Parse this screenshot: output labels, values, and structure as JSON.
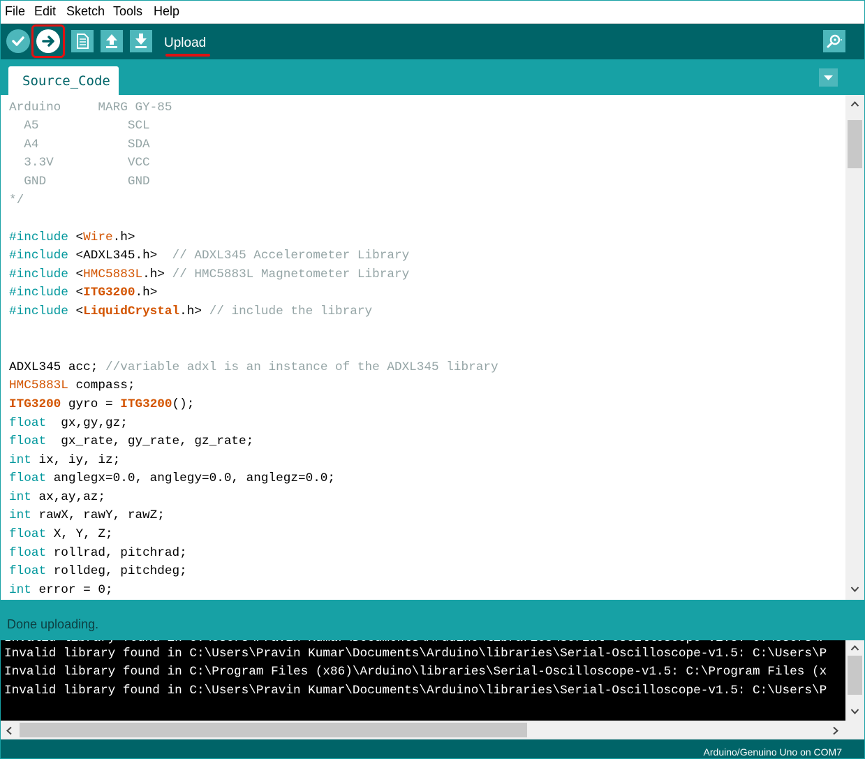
{
  "menu": [
    "File",
    "Edit",
    "Sketch",
    "Tools",
    "Help"
  ],
  "toolbar": {
    "hover_label": "Upload",
    "buttons": [
      "verify-icon",
      "upload-icon",
      "new-icon",
      "open-icon",
      "save-icon",
      "serial-monitor-icon"
    ]
  },
  "tab": {
    "label": "Source_Code"
  },
  "code": {
    "c1": "Arduino     MARG GY-85",
    "c2": "  A5            SCL",
    "c3": "  A4            SDA",
    "c4": "  3.3V          VCC",
    "c5": "  GND           GND",
    "c6": "*/",
    "inc_kw": "#include",
    "inc1_lib": "Wire",
    "inc1_tail": ".h>",
    "inc2_text": "ADXL345.h>",
    "inc2_comment": "  // ADXL345 Accelerometer Library",
    "inc3_lib": "HMC5883L",
    "inc3_tail": ".h>",
    "inc3_comment": " // HMC5883L Magnetometer Library",
    "inc4_lib": "ITG3200",
    "inc4_tail": ".h>",
    "inc5_lib": "LiquidCrystal",
    "inc5_tail": ".h>",
    "inc5_comment": " // include the library",
    "l1_text": "ADXL345 acc; ",
    "l1_comment": "//variable adxl is an instance of the ADXL345 library",
    "l2_lib": "HMC5883L",
    "l2_text": " compass;",
    "l3_lib": "ITG3200",
    "l3_mid": " gyro = ",
    "l3_lib2": "ITG3200",
    "l3_end": "();",
    "t_float": "float",
    "t_int": "int",
    "l4_text": "  gx,gy,gz;",
    "l5_text": "  gx_rate, gy_rate, gz_rate;",
    "l6_text": " ix, iy, iz;",
    "l7_text": " anglegx=0.0, anglegy=0.0, anglegz=0.0;",
    "l8_text": " ax,ay,az;",
    "l9_text": " rawX, rawY, rawZ;",
    "l10_text": " X, Y, Z;",
    "l11_text": " rollrad, pitchrad;",
    "l12_text": " rolldeg, pitchdeg;",
    "l13_text": " error = 0;"
  },
  "status": "Done uploading.",
  "console": [
    "Invalid library found in C:\\Users\\Pravin Kumar\\Documents\\Arduino\\libraries\\Serial-Oscilloscope-v1.5: C:\\Users\\P",
    "Invalid library found in C:\\Program Files (x86)\\Arduino\\libraries\\Serial-Oscilloscope-v1.5: C:\\Program Files (x",
    "Invalid library found in C:\\Users\\Pravin Kumar\\Documents\\Arduino\\libraries\\Serial-Oscilloscope-v1.5: C:\\Users\\P"
  ],
  "board": "Arduino/Genuino Uno on COM7",
  "colors": {
    "teal_dark": "#006468",
    "teal": "#17a1a5",
    "button": "#4db7bb",
    "highlight": "#e01212"
  }
}
